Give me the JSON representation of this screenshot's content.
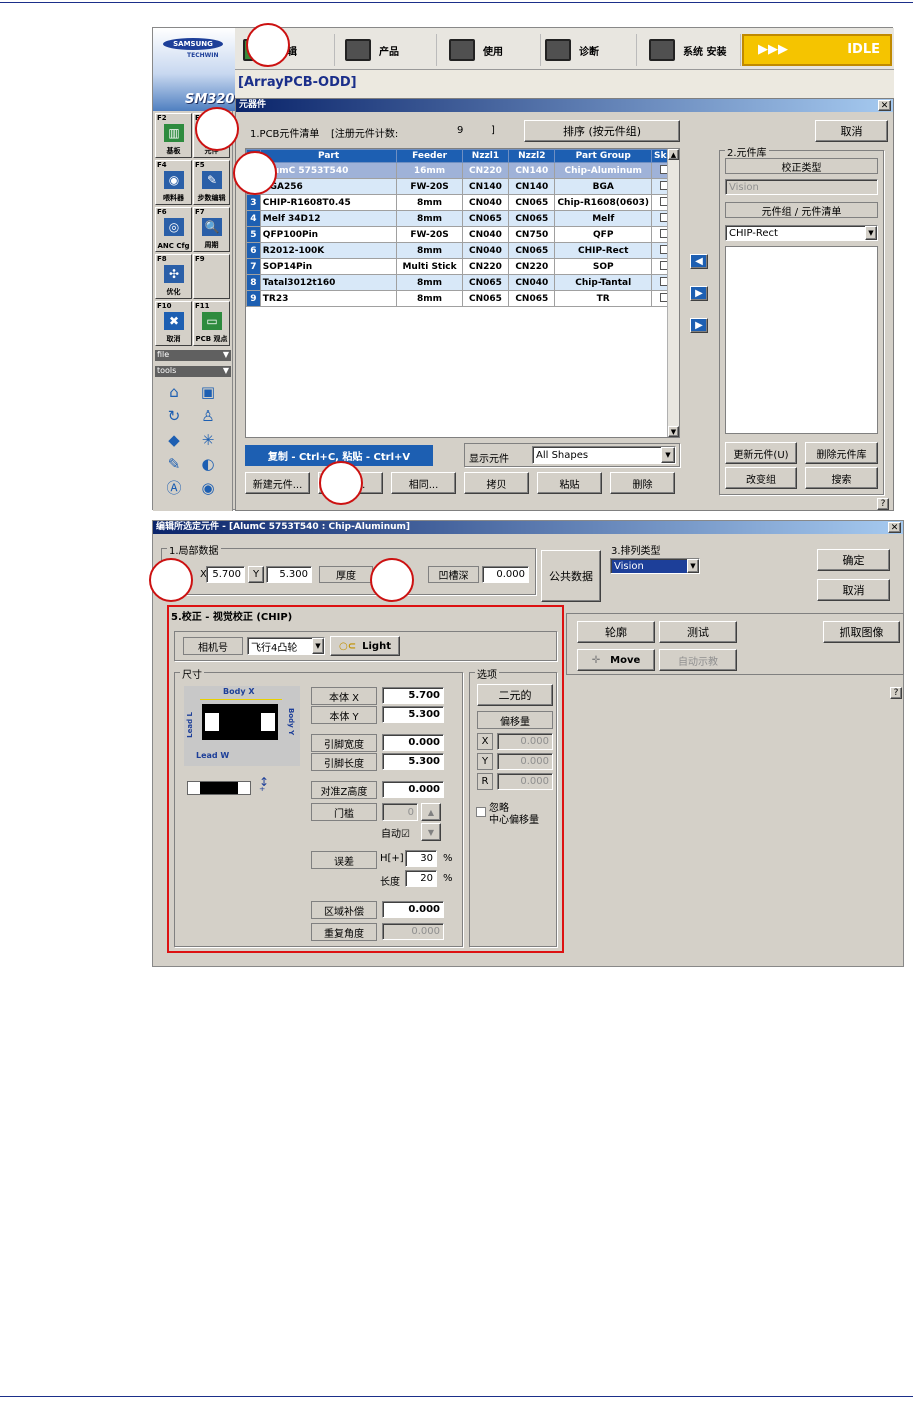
{
  "topbar": {
    "logo_line1": "SAMSUNG",
    "logo_line2": "TECHWIN",
    "brand": "SM320",
    "title": "[ArrayPCB-ODD]",
    "menu": [
      {
        "label": "编辑"
      },
      {
        "label": "产品"
      },
      {
        "label": "使用"
      },
      {
        "label": "诊断"
      },
      {
        "label": "系统 安装"
      }
    ],
    "status": "IDLE",
    "arrows": "▶▶▶"
  },
  "sidebar": {
    "fkeys": [
      {
        "key": "F2",
        "label": "基板"
      },
      {
        "key": "F3",
        "label": "元件"
      },
      {
        "key": "F4",
        "label": "喂料器"
      },
      {
        "key": "F5",
        "label": "步数编辑"
      },
      {
        "key": "F6",
        "label": "ANC Cfg"
      },
      {
        "key": "F7",
        "label": "周期"
      },
      {
        "key": "F8",
        "label": "优化"
      },
      {
        "key": "F9",
        "label": ""
      },
      {
        "key": "F10",
        "label": "取消"
      },
      {
        "key": "F11",
        "label": "PCB 观点"
      }
    ],
    "file_menu": "file",
    "tools_menu": "tools"
  },
  "parts_dialog": {
    "title": "元器件",
    "list_title": "1.PCB元件清单",
    "count_label": "[注册元件计数:",
    "count": "9",
    "count_end": "]",
    "sort_button": "排序 (按元件组)",
    "cancel_button": "取消",
    "columns": [
      "Part",
      "Feeder",
      "Nzzl1",
      "Nzzl2",
      "Part Group",
      "Skip"
    ],
    "rows": [
      {
        "n": "1",
        "part": "AlumC 5753T540",
        "feeder": "16mm",
        "n1": "CN220",
        "n2": "CN140",
        "group": "Chip-Aluminum"
      },
      {
        "n": "2",
        "part": "BGA256",
        "feeder": "FW-20S",
        "n1": "CN140",
        "n2": "CN140",
        "group": "BGA"
      },
      {
        "n": "3",
        "part": "CHIP-R1608T0.45",
        "feeder": "8mm",
        "n1": "CN040",
        "n2": "CN065",
        "group": "Chip-R1608(0603)"
      },
      {
        "n": "4",
        "part": "Melf 34D12",
        "feeder": "8mm",
        "n1": "CN065",
        "n2": "CN065",
        "group": "Melf"
      },
      {
        "n": "5",
        "part": "QFP100Pin",
        "feeder": "FW-20S",
        "n1": "CN040",
        "n2": "CN750",
        "group": "QFP"
      },
      {
        "n": "6",
        "part": "R2012-100K",
        "feeder": "8mm",
        "n1": "CN040",
        "n2": "CN065",
        "group": "CHIP-Rect"
      },
      {
        "n": "7",
        "part": "SOP14Pin",
        "feeder": "Multi Stick",
        "n1": "CN220",
        "n2": "CN220",
        "group": "SOP"
      },
      {
        "n": "8",
        "part": "Tatal3012t160",
        "feeder": "8mm",
        "n1": "CN065",
        "n2": "CN040",
        "group": "Chip-Tantal"
      },
      {
        "n": "9",
        "part": "TR23",
        "feeder": "8mm",
        "n1": "CN065",
        "n2": "CN065",
        "group": "TR"
      }
    ],
    "copy_hint": "复制 - Ctrl+C, 粘贴 - Ctrl+V",
    "show_label": "显示元件",
    "show_value": "All Shapes",
    "buttons": [
      "新建元件...",
      "编辑...",
      "相同...",
      "拷贝",
      "粘贴",
      "删除"
    ],
    "library": {
      "title": "2.元件库",
      "calib_label": "校正类型",
      "calib_value": "Vision",
      "group_label": "元件组 / 元件清单",
      "group_value": "CHIP-Rect",
      "update_button": "更新元件(U)",
      "delete_button": "删除元件库",
      "change_group_button": "改变组",
      "search_button": "搜索"
    },
    "help": "?"
  },
  "edit_dialog": {
    "title": "编辑所选定元件 - [AlumC 5753T540 : Chip-Aluminum]",
    "local_title": "1.局部数据",
    "x_label": "X",
    "x_value": "5.700",
    "y_label": "Y",
    "y_value": "5.300",
    "thickness_label": "厚度",
    "recess_label": "凹槽深",
    "recess_value": "0.000",
    "common_button": "公共数据",
    "arrange_label": "3.排列类型",
    "arrange_value": "Vision",
    "ok_button": "确定",
    "cancel_button": "取消",
    "calib_title": "5.校正 - 视觉校正 (CHIP)",
    "camera_label": "相机号",
    "camera_value": "飞行4凸轮",
    "light_button": "Light",
    "size_title": "尺寸",
    "body_x_lbl": "Body X",
    "body_y_lbl": "Body Y",
    "lead_l_lbl": "Lead L",
    "lead_w_lbl": "Lead W",
    "fields": [
      {
        "label": "本体 X",
        "value": "5.700"
      },
      {
        "label": "本体 Y",
        "value": "5.300"
      },
      {
        "label": "引脚宽度",
        "value": "0.000"
      },
      {
        "label": "引脚长度",
        "value": "5.300"
      },
      {
        "label": "对准Z高度",
        "value": "0.000"
      }
    ],
    "threshold_label": "门槛",
    "threshold_value": "0",
    "auto_label": "自动☑",
    "error_label": "误差",
    "h_label": "H[+]",
    "h_value": "30",
    "len_label": "长度",
    "len_value": "20",
    "pct": "%",
    "area_label": "区域补偿",
    "area_value": "0.000",
    "repeat_label": "重复角度",
    "repeat_value": "0.000",
    "options_title": "选项",
    "binary_button": "二元的",
    "offset_label": "偏移量",
    "offsets": [
      {
        "axis": "X",
        "value": "0.000"
      },
      {
        "axis": "Y",
        "value": "0.000"
      },
      {
        "axis": "R",
        "value": "0.000"
      }
    ],
    "ignore_label": "忽略\n中心偏移量",
    "outline_button": "轮廓",
    "test_button": "测试",
    "capture_button": "抓取图像",
    "move_button": "Move",
    "autoteach_button": "自动示教",
    "help": "?"
  }
}
